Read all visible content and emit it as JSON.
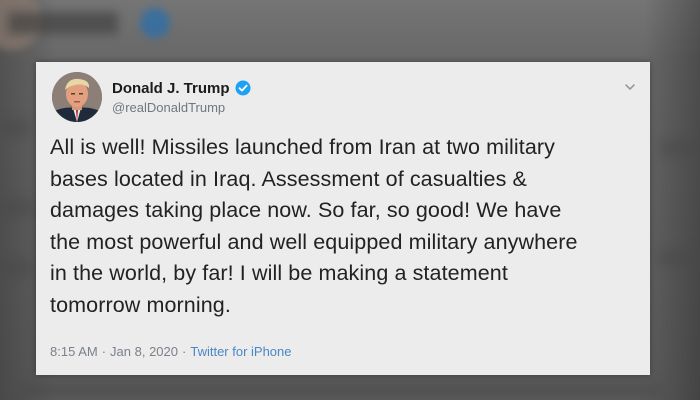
{
  "tweet": {
    "display_name": "Donald J. Trump",
    "handle": "@realDonaldTrump",
    "verified": true,
    "text": "All is well! Missiles launched from Iran at two military\nbases located in Iraq. Assessment of casualties &\ndamages taking place now. So far, so good! We have\nthe most powerful and well equipped military anywhere\nin the world, by far! I will be making a statement\ntomorrow morning.",
    "time": "8:15 AM",
    "date": "Jan 8, 2020",
    "separator": "·",
    "source": "Twitter for iPhone"
  },
  "colors": {
    "card_background": "#ececec",
    "verified_badge": "#1da1f2",
    "source_link": "#4a87c6",
    "backdrop": "#616161"
  },
  "icons": {
    "verified": "verified-badge-icon",
    "caret": "chevron-down-icon"
  }
}
